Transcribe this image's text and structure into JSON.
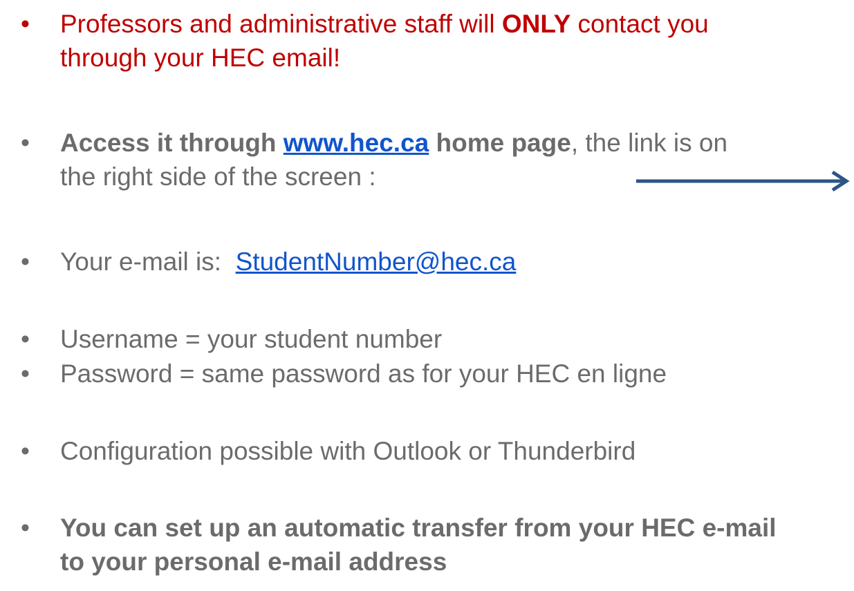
{
  "bullets": {
    "b1": {
      "pre": "Professors and administrative staff will ",
      "emph": "ONLY",
      "post": " contact you",
      "line2": "through your HEC email!"
    },
    "b2": {
      "bold_pre": "Access it through ",
      "link": "www.hec.ca",
      "bold_post": " home page",
      "rest": ", the link is on",
      "line2": "the right side of the screen :"
    },
    "b3": {
      "pre": "Your e-mail is:  ",
      "link": "StudentNumber@hec.ca"
    },
    "b4": {
      "text": "Username = your student number"
    },
    "b5": {
      "text": "Password = same password as for your HEC en ligne"
    },
    "b6": {
      "text": "Configuration possible with Outlook or Thunderbird"
    },
    "b7": {
      "line1": "You can set up an automatic transfer from your HEC e-mail",
      "line2": "to your personal e-mail address"
    }
  },
  "bullet_symbol": "•",
  "colors": {
    "emphasis_red": "#c00000",
    "body_gray": "#6b6b6b",
    "link_blue": "#1155cc",
    "arrow_blue": "#2e5487"
  },
  "icons": {
    "arrow": "arrow-right-icon"
  }
}
